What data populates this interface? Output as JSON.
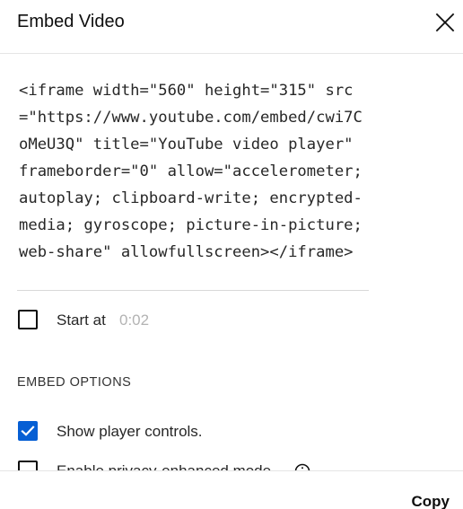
{
  "dialog": {
    "title": "Embed Video",
    "close_icon": "close-icon"
  },
  "embed_code": "<iframe width=\"560\" height=\"315\" src=\"https://www.youtube.com/embed/cwi7CoMeU3Q\" title=\"YouTube video player\" frameborder=\"0\" allow=\"accelerometer; autoplay; clipboard-write; encrypted-media; gyroscope; picture-in-picture; web-share\" allowfullscreen></iframe>",
  "start_at": {
    "checked": false,
    "label": "Start at",
    "time": "0:02"
  },
  "embed_options": {
    "heading": "EMBED OPTIONS",
    "options": [
      {
        "label": "Show player controls.",
        "checked": true
      },
      {
        "label": "Enable privacy-enhanced mode.",
        "checked": false,
        "info_icon": "info-icon"
      }
    ]
  },
  "footer": {
    "copy_label": "Copy"
  },
  "colors": {
    "accent": "#065fd4",
    "text": "#0f0f0f",
    "placeholder": "#b3b3b3",
    "divider": "#e5e5e5"
  }
}
